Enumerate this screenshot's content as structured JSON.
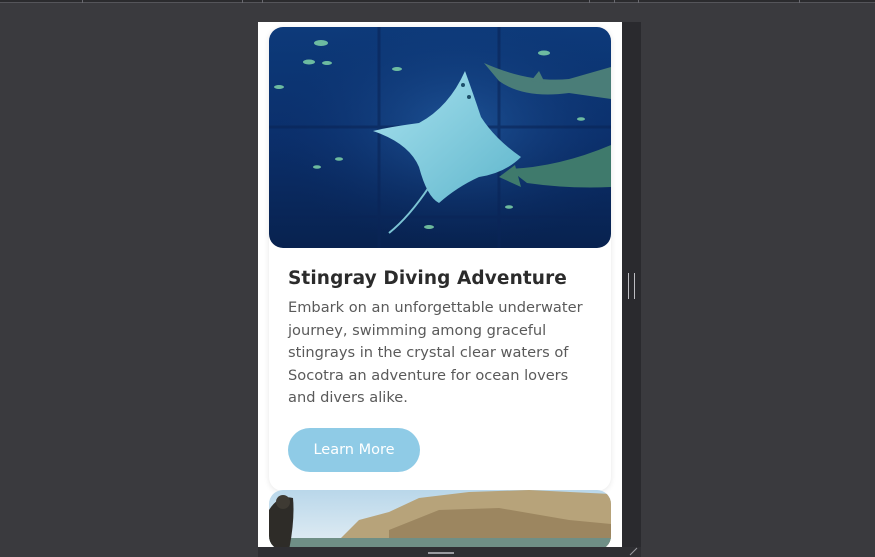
{
  "card": {
    "title": "Stingray Diving Adventure",
    "description": "Embark on an unforgettable underwater journey, swimming among graceful stingrays in the crystal clear waters of Socotra an adventure for ocean lovers and divers alike.",
    "button_label": "Learn More",
    "image_alt": "stingray-underwater-photo"
  },
  "next_card": {
    "image_alt": "coastal-cliffs-photo"
  },
  "colors": {
    "button": "#8fcbe6",
    "title": "#2b2b2b",
    "description": "#5a5a5a",
    "background": "#3a3a3e"
  }
}
